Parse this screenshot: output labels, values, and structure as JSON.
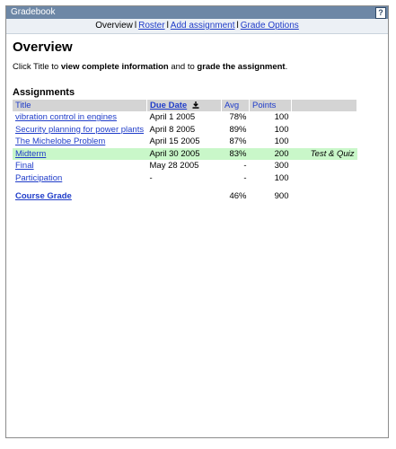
{
  "window": {
    "title": "Gradebook",
    "help_icon": "?"
  },
  "nav": {
    "items": [
      {
        "label": "Overview",
        "link": false
      },
      {
        "label": "Roster",
        "link": true
      },
      {
        "label": "Add assignment",
        "link": true
      },
      {
        "label": "Grade Options",
        "link": true
      }
    ],
    "separator": "l"
  },
  "page": {
    "title": "Overview",
    "instruction_pre": "Click Title to ",
    "instruction_bold1": "view complete information",
    "instruction_mid": " and to ",
    "instruction_bold2": "grade the assignment",
    "instruction_post": "."
  },
  "assignments": {
    "heading": "Assignments",
    "columns": {
      "title": "Title",
      "due": "Due Date",
      "avg": "Avg",
      "points": "Points"
    },
    "sort_icon": "download-arrow-icon",
    "rows": [
      {
        "title": "vibration control in engines",
        "due": "April 1 2005",
        "avg": "78%",
        "points": "100",
        "note": ""
      },
      {
        "title": "Security planning for power plants",
        "due": "April 8 2005",
        "avg": "89%",
        "points": "100",
        "note": ""
      },
      {
        "title": "The Michelobe Problem",
        "due": "April 15 2005",
        "avg": "87%",
        "points": "100",
        "note": ""
      },
      {
        "title": "Midterm",
        "due": "April 30 2005",
        "avg": "83%",
        "points": "200",
        "note": "Test & Quiz"
      },
      {
        "title": "Final",
        "due": "May 28 2005",
        "avg": "-",
        "points": "300",
        "note": ""
      },
      {
        "title": "Participation",
        "due": "-",
        "avg": "-",
        "points": "100",
        "note": ""
      }
    ],
    "total": {
      "title": "Course Grade",
      "avg": "46%",
      "points": "900"
    }
  },
  "colors": {
    "titlebar": "#6d87a6",
    "link": "#1f3cc9",
    "header_bg": "#d4d4d4",
    "highlight_row": "#c9f7c9"
  }
}
